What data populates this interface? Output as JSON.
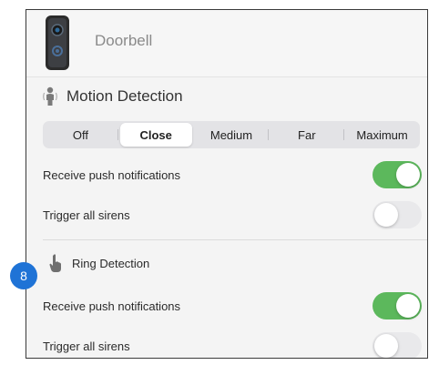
{
  "device": {
    "name": "Doorbell",
    "icon": "doorbell-icon"
  },
  "motion_detection": {
    "title": "Motion Detection",
    "icon": "person-icon",
    "range_options": [
      "Off",
      "Close",
      "Medium",
      "Far",
      "Maximum"
    ],
    "selected_range": "Close",
    "rows": [
      {
        "label": "Receive push notifications",
        "on": true
      },
      {
        "label": "Trigger all sirens",
        "on": false
      }
    ]
  },
  "ring_detection": {
    "title": "Ring Detection",
    "icon": "hand-pointer-icon",
    "rows": [
      {
        "label": "Receive push notifications",
        "on": true
      },
      {
        "label": "Trigger all sirens",
        "on": false
      }
    ]
  },
  "callout": {
    "number": "8",
    "color": "#1f73d6"
  },
  "colors": {
    "toggle_on": "#5cb85c",
    "toggle_off": "#e9e9eb"
  }
}
